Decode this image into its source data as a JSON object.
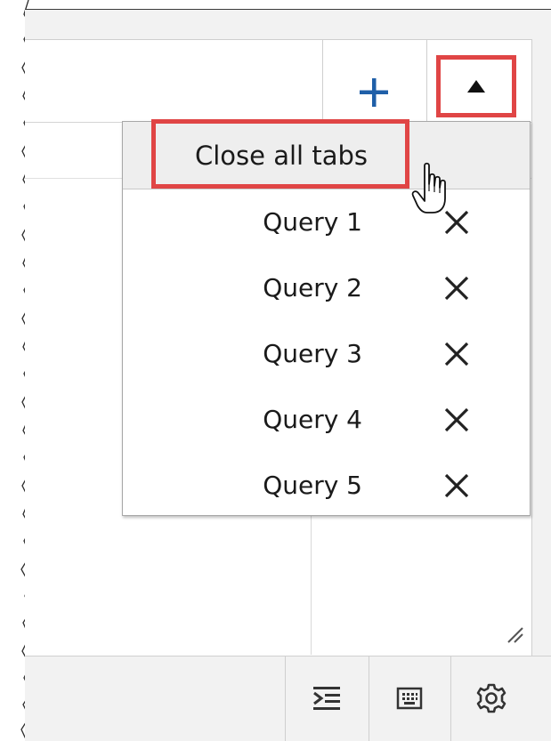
{
  "tab_bar": {
    "add_tab_icon": "plus-icon",
    "tabs_menu_icon": "caret-up-icon",
    "accent_color": "#1f5fa8"
  },
  "tabs_menu": {
    "close_all_label": "Close all tabs",
    "items": [
      {
        "label": "Query 1",
        "close_icon": "close-icon"
      },
      {
        "label": "Query 2",
        "close_icon": "close-icon"
      },
      {
        "label": "Query 3",
        "close_icon": "close-icon"
      },
      {
        "label": "Query 4",
        "close_icon": "close-icon"
      },
      {
        "label": "Query 5",
        "close_icon": "close-icon"
      }
    ]
  },
  "toolbar": {
    "buttons": [
      {
        "icon": "format-indent-icon"
      },
      {
        "icon": "keyboard-icon"
      },
      {
        "icon": "gear-icon"
      }
    ]
  },
  "annotations": {
    "highlight_color": "#e04545"
  }
}
